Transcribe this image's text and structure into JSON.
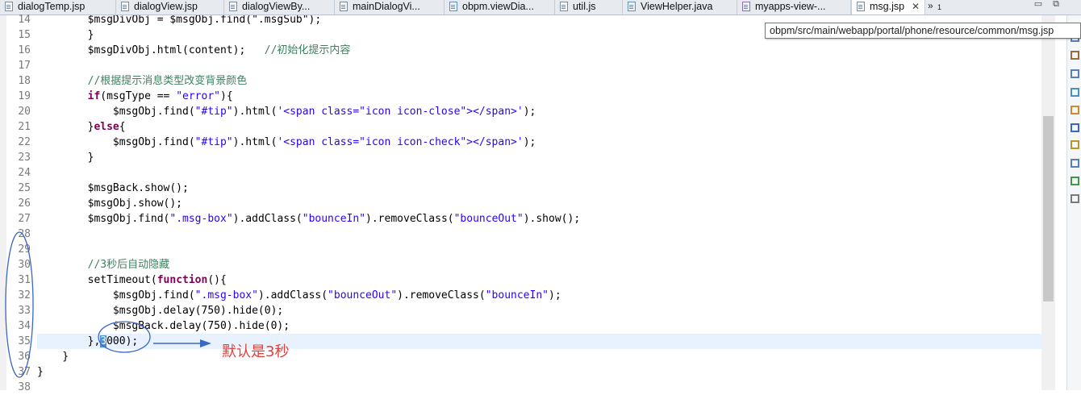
{
  "tabs": [
    {
      "label": "dialogTemp.jsp",
      "kind": "jsp"
    },
    {
      "label": "dialogView.jsp",
      "kind": "jsp"
    },
    {
      "label": "dialogViewBy...",
      "kind": "jsp"
    },
    {
      "label": "mainDialogVi...",
      "kind": "jsp"
    },
    {
      "label": "obpm.viewDia...",
      "kind": "java"
    },
    {
      "label": "util.js",
      "kind": "js"
    },
    {
      "label": "ViewHelper.java",
      "kind": "java"
    },
    {
      "label": "myapps-view-...",
      "kind": "xml"
    },
    {
      "label": "msg.jsp",
      "kind": "jsp",
      "active": true,
      "close": "✕"
    }
  ],
  "overflow": {
    "symbol": "»",
    "count": "1"
  },
  "window_controls": {
    "minimize": "▭",
    "restore": "⧉"
  },
  "tooltip": "obpm/src/main/webapp/portal/phone/resource/common/msg.jsp",
  "editor": {
    "current_line": "35",
    "lines": [
      {
        "n": "14",
        "parts": [
          [
            "t",
            "        $msgDivObj = $msgObj.find(\".msgSub\");"
          ]
        ]
      },
      {
        "n": "15",
        "parts": [
          [
            "t",
            "        }"
          ]
        ]
      },
      {
        "n": "16",
        "parts": [
          [
            "t",
            "        $msgDivObj.html(content);   "
          ],
          [
            "cm",
            "//初始化提示内容"
          ]
        ]
      },
      {
        "n": "17",
        "parts": []
      },
      {
        "n": "18",
        "parts": [
          [
            "cm",
            "        //根据提示消息类型改变背景颜色"
          ]
        ]
      },
      {
        "n": "19",
        "parts": [
          [
            "t",
            "        "
          ],
          [
            "kw",
            "if"
          ],
          [
            "t",
            "(msgType == "
          ],
          [
            "str",
            "\"error\""
          ],
          [
            "t",
            "){"
          ]
        ]
      },
      {
        "n": "20",
        "parts": [
          [
            "t",
            "            $msgObj.find("
          ],
          [
            "str",
            "\"#tip\""
          ],
          [
            "t",
            ").html("
          ],
          [
            "str",
            "'<span class=\"icon icon-close\"></span>'"
          ],
          [
            "t",
            ");"
          ]
        ]
      },
      {
        "n": "21",
        "parts": [
          [
            "t",
            "        }"
          ],
          [
            "kw",
            "else"
          ],
          [
            "t",
            "{"
          ]
        ]
      },
      {
        "n": "22",
        "parts": [
          [
            "t",
            "            $msgObj.find("
          ],
          [
            "str",
            "\"#tip\""
          ],
          [
            "t",
            ").html("
          ],
          [
            "str",
            "'<span class=\"icon icon-check\"></span>'"
          ],
          [
            "t",
            ");"
          ]
        ]
      },
      {
        "n": "23",
        "parts": [
          [
            "t",
            "        }"
          ]
        ]
      },
      {
        "n": "24",
        "parts": []
      },
      {
        "n": "25",
        "parts": [
          [
            "t",
            "        $msgBack.show();"
          ]
        ]
      },
      {
        "n": "26",
        "parts": [
          [
            "t",
            "        $msgObj.show();"
          ]
        ]
      },
      {
        "n": "27",
        "parts": [
          [
            "t",
            "        $msgObj.find("
          ],
          [
            "str",
            "\".msg-box\""
          ],
          [
            "t",
            ").addClass("
          ],
          [
            "str",
            "\"bounceIn\""
          ],
          [
            "t",
            ").removeClass("
          ],
          [
            "str",
            "\"bounceOut\""
          ],
          [
            "t",
            ").show();"
          ]
        ]
      },
      {
        "n": "28",
        "parts": []
      },
      {
        "n": "29",
        "parts": []
      },
      {
        "n": "30",
        "parts": [
          [
            "cm",
            "        //3秒后自动隐藏"
          ]
        ]
      },
      {
        "n": "31",
        "parts": [
          [
            "t",
            "        setTimeout("
          ],
          [
            "kw",
            "function"
          ],
          [
            "t",
            "(){"
          ]
        ]
      },
      {
        "n": "32",
        "parts": [
          [
            "t",
            "            $msgObj.find("
          ],
          [
            "str",
            "\".msg-box\""
          ],
          [
            "t",
            ").addClass("
          ],
          [
            "str",
            "\"bounceOut\""
          ],
          [
            "t",
            ").removeClass("
          ],
          [
            "str",
            "\"bounceIn\""
          ],
          [
            "t",
            ");"
          ]
        ]
      },
      {
        "n": "33",
        "parts": [
          [
            "t",
            "            $msgObj.delay(750).hide(0);"
          ]
        ]
      },
      {
        "n": "34",
        "parts": [
          [
            "t",
            "            $msgBack.delay(750).hide(0);"
          ]
        ]
      },
      {
        "n": "35",
        "parts": [
          [
            "t",
            "        },"
          ],
          [
            "sel",
            "3"
          ],
          [
            "t",
            "000);"
          ]
        ]
      },
      {
        "n": "36",
        "parts": [
          [
            "t",
            "    }"
          ]
        ]
      },
      {
        "n": "37",
        "parts": [
          [
            "t",
            "}"
          ]
        ]
      },
      {
        "n": "38",
        "parts": []
      }
    ]
  },
  "annotation": {
    "text": "默认是3秒",
    "color": "#e0403a",
    "ink_color": "#3a66c4"
  },
  "colors": {
    "keyword": "#7f0055",
    "string": "#2a00ff",
    "comment": "#3f7f5f",
    "current_line_bg": "#e8f2fe"
  }
}
